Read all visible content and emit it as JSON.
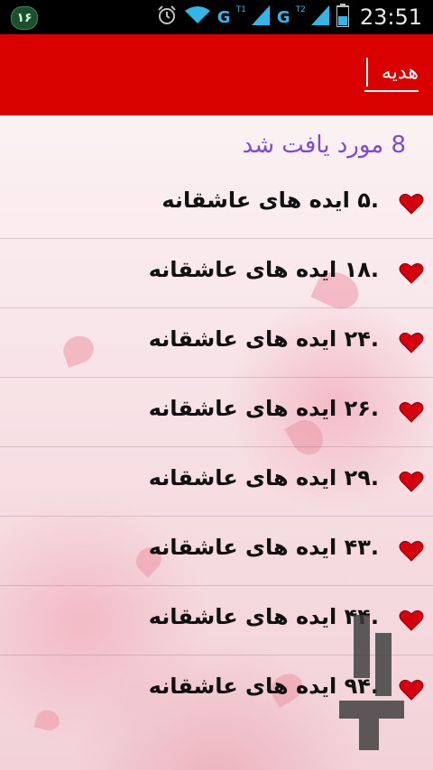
{
  "status_bar": {
    "notification_badge": "۱۶",
    "carrier1": "G",
    "carrier1_sup": "T1",
    "carrier2": "G",
    "carrier2_sup": "T2",
    "time": "23:51",
    "icons": [
      "alarm-icon",
      "wifi-icon",
      "signal-icon",
      "signal-icon",
      "battery-icon"
    ]
  },
  "app_bar": {
    "search_value": "هدیه",
    "accent_color": "#d90000"
  },
  "results": {
    "count_text": "8 مورد یافت شد",
    "items": [
      {
        "label": ".۵  ایده های عاشقانه"
      },
      {
        "label": ".۱۸  ایده های عاشقانه"
      },
      {
        "label": ".۲۴  ایده های عاشقانه"
      },
      {
        "label": ".۲۶  ایده های عاشقانه"
      },
      {
        "label": ".۲۹  ایده های عاشقانه"
      },
      {
        "label": ".۴۳  ایده های عاشقانه"
      },
      {
        "label": ".۴۴  ایده های عاشقانه"
      },
      {
        "label": ".۹۴  ایده های عاشقانه"
      }
    ],
    "item_icon": "heart-icon",
    "heart_color": "#d40010"
  },
  "watermark": {
    "icon": "bazaar-logo-icon"
  }
}
